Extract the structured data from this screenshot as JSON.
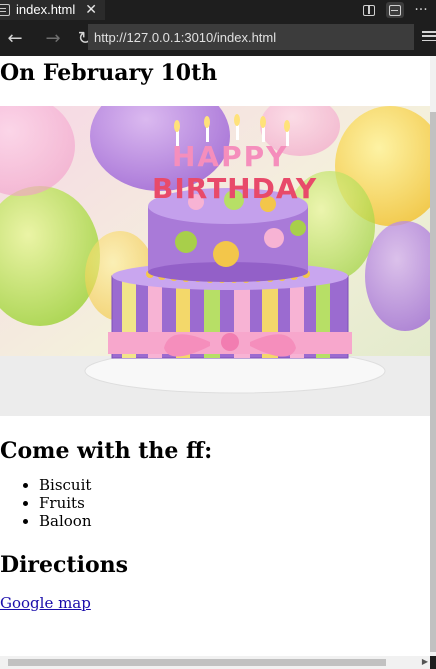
{
  "tab": {
    "title": "index.html",
    "close_glyph": "✕"
  },
  "tab_actions": {
    "split_icon": "split-editor-icon",
    "layout_icon": "toggle-layout-icon",
    "more_glyph": "···"
  },
  "nav": {
    "back_glyph": "←",
    "forward_glyph": "→",
    "reload_glyph": "↻",
    "url": "http://127.0.0.1:3010/index.html"
  },
  "page": {
    "date_heading": "On February 10th",
    "cake_banner_text": "HAPPY BIRTHDAY",
    "ff_heading": "Come with the ff:",
    "items": [
      "Biscuit",
      "Fruits",
      "Baloon"
    ],
    "directions_heading": "Directions",
    "map_link": "Google map"
  },
  "colors": {
    "editor_bg": "#1e1e1e",
    "url_bg": "#3c3c3c",
    "link": "#1a0dab"
  }
}
